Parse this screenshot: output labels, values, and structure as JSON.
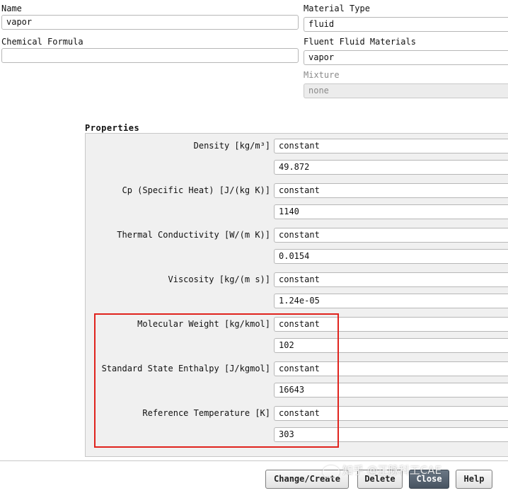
{
  "name": {
    "label": "Name",
    "value": "vapor"
  },
  "chemical_formula": {
    "label": "Chemical Formula",
    "value": ""
  },
  "material_type": {
    "label": "Material Type",
    "value": "fluid"
  },
  "fluent_fluid_materials": {
    "label": "Fluent Fluid Materials",
    "value": "vapor"
  },
  "mixture": {
    "label": "Mixture",
    "value": "none"
  },
  "properties": {
    "title": "Properties",
    "items": [
      {
        "label": "Density [kg/m³]",
        "method": "constant",
        "value": "49.872"
      },
      {
        "label": "Cp (Specific Heat) [J/(kg K)]",
        "method": "constant",
        "value": "1140"
      },
      {
        "label": "Thermal Conductivity [W/(m K)]",
        "method": "constant",
        "value": "0.0154"
      },
      {
        "label": "Viscosity [kg/(m s)]",
        "method": "constant",
        "value": "1.24e-05"
      },
      {
        "label": "Molecular Weight [kg/kmol]",
        "method": "constant",
        "value": "102"
      },
      {
        "label": "Standard State Enthalpy [J/kgmol]",
        "method": "constant",
        "value": "16643"
      },
      {
        "label": "Reference Temperature [K]",
        "method": "constant",
        "value": "303"
      }
    ]
  },
  "buttons": {
    "change_create": "Change/Create",
    "delete": "Delete",
    "close": "Close",
    "help": "Help"
  },
  "watermark": "知乎 @正脉科工CAE",
  "colors": {
    "highlight": "#e0231d",
    "panel_bg": "#f0f0f0",
    "close_button": "#4f5b68"
  }
}
